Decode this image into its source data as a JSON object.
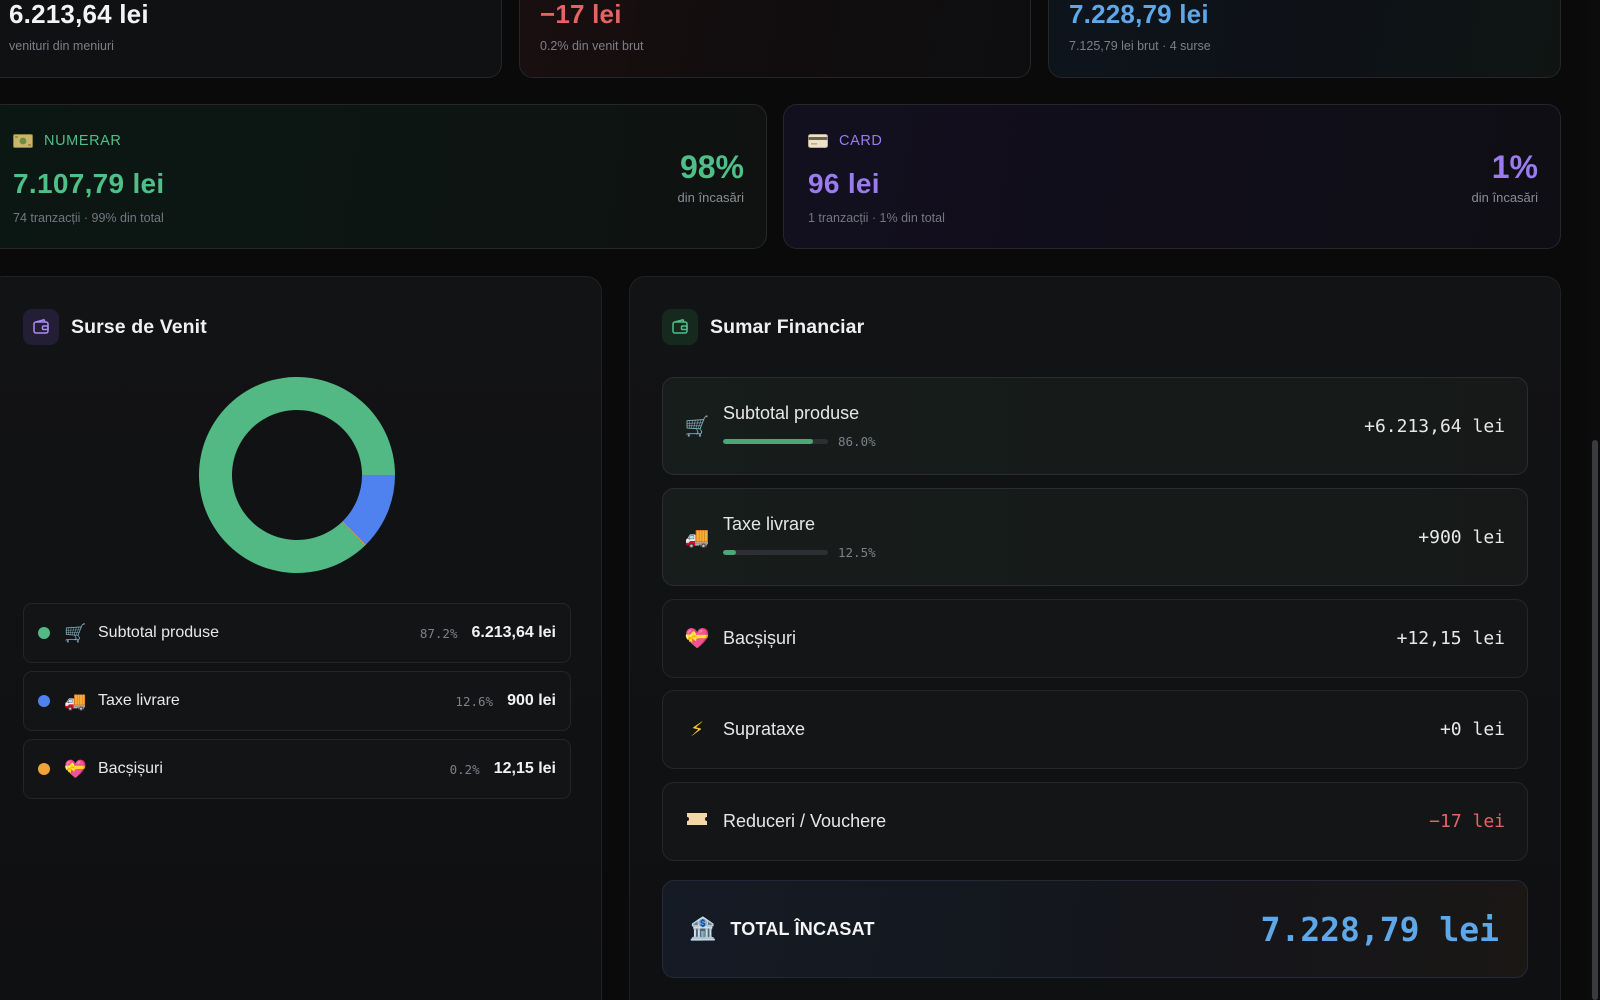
{
  "colors": {
    "green": "#4fbf88",
    "red": "#e46464",
    "blue": "#5ea7e8",
    "purple": "#9a7cf0",
    "donut_green": "#52b985",
    "donut_blue": "#4f82ee",
    "donut_orange": "#f1a33a"
  },
  "top_cards": [
    {
      "value": "6.213,64 lei",
      "sub": "venituri din meniuri"
    },
    {
      "value": "−17 lei",
      "sub": "0.2% din venit brut"
    },
    {
      "value": "7.228,79 lei",
      "sub": "7.125,79 lei brut · 4 surse"
    }
  ],
  "payments": {
    "cash": {
      "icon": "banknote-icon",
      "label": "NUMERAR",
      "amount": "7.107,79 lei",
      "sub": "74 tranzacții · 99% din total",
      "pct": "98%",
      "pct_label": "din încasări"
    },
    "card": {
      "icon": "credit-card-icon",
      "label": "CARD",
      "amount": "96 lei",
      "sub": "1 tranzacții · 1% din total",
      "pct": "1%",
      "pct_label": "din încasări"
    }
  },
  "sources": {
    "title": "Surse de Venit",
    "icon": "wallet-icon",
    "items": [
      {
        "icon": "cart-icon",
        "label": "Subtotal produse",
        "pct": "87.2%",
        "value": "6.213,64 lei"
      },
      {
        "icon": "truck-icon",
        "label": "Taxe livrare",
        "pct": "12.6%",
        "value": "900 lei"
      },
      {
        "icon": "heart-gift-icon",
        "label": "Bacșișuri",
        "pct": "0.2%",
        "value": "12,15 lei"
      }
    ]
  },
  "chart_data": {
    "type": "pie",
    "categories": [
      "Subtotal produse",
      "Taxe livrare",
      "Bacșișuri"
    ],
    "values": [
      87.2,
      12.6,
      0.2
    ]
  },
  "summary": {
    "title": "Sumar Financiar",
    "icon": "wallet-icon",
    "rows": [
      {
        "icon": "cart-icon",
        "label": "Subtotal produse",
        "pct": "86.0%",
        "progress": 0.86,
        "value": "+6.213,64 lei"
      },
      {
        "icon": "truck-icon",
        "label": "Taxe livrare",
        "pct": "12.5%",
        "progress": 0.125,
        "value": "+900 lei"
      },
      {
        "icon": "heart-gift-icon",
        "label": "Bacșișuri",
        "value": "+12,15 lei"
      },
      {
        "icon": "lightning-icon",
        "label": "Suprataxe",
        "value": "+0 lei"
      },
      {
        "icon": "ticket-icon",
        "label": "Reduceri / Vouchere",
        "value": "−17 lei"
      }
    ],
    "total": {
      "icon": "bank-icon",
      "label": "TOTAL ÎNCASAT",
      "value": "7.228,79 lei"
    }
  }
}
